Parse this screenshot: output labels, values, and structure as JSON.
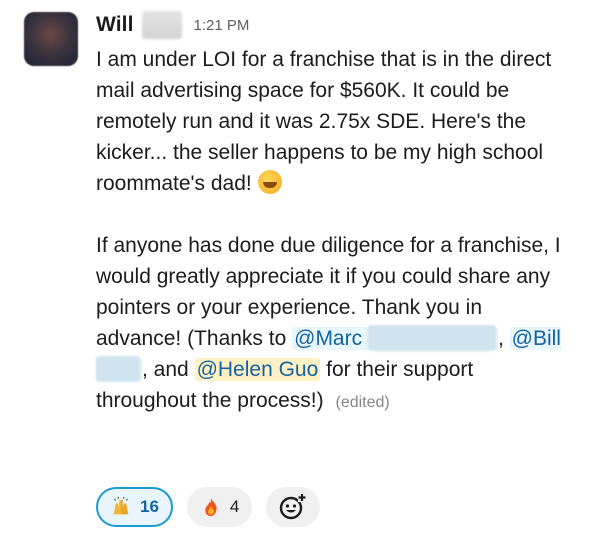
{
  "message": {
    "sender": "Will",
    "timestamp": "1:21 PM",
    "paragraph1": "I am under LOI for a franchise that is in the direct mail advertising space for $560K. It could be remotely run and it was 2.75x SDE. Here's the kicker... the seller happens to be my high school roommate's dad!",
    "paragraph2_main": "If anyone has done due diligence for a franchise, I would greatly appreciate it if you could share any pointers or your experience. Thank you in advance! (Thanks to",
    "mention1": "@Marc",
    "sep1": ",",
    "mention2": "@Bill",
    "sep2": ", and",
    "mention3": "@Helen Guo",
    "tail": "for their support throughout the process!)",
    "edited": "(edited)",
    "emoji_in_text": "rolling-on-floor-laughing-emoji"
  },
  "reactions": [
    {
      "icon": "raising-hands-icon",
      "count": "16",
      "active": true
    },
    {
      "icon": "fire-icon",
      "count": "4",
      "active": false
    }
  ],
  "add_reaction": {
    "icon": "add-reaction-icon"
  }
}
